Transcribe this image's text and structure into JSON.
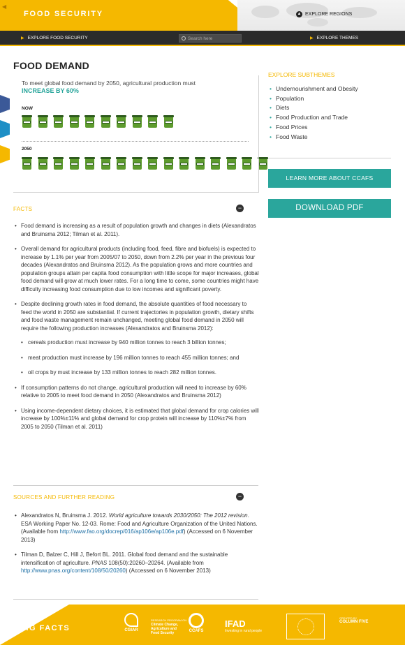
{
  "header": {
    "back_icon": "triangle-left",
    "title": "FOOD SECURITY",
    "explore_regions": "EXPLORE REGIONS",
    "regions_icon_glyph": "▲"
  },
  "navbar": {
    "explore_food_security": "EXPLORE FOOD SECURITY",
    "search_placeholder": "Search here",
    "explore_themes": "EXPLORE THEMES"
  },
  "main": {
    "page_title": "FOOD DEMAND",
    "intro_text": "To meet global food demand by 2050, agricultural production must",
    "highlight": "INCREASE BY 60%",
    "now_label": "NOW",
    "future_label": "2050",
    "bins_now": 10,
    "bins_2050": 16
  },
  "facts": {
    "heading": "FACTS",
    "collapse_glyph": "−",
    "items": [
      "Food demand is increasing as a result of population growth and changes in diets (Alexandratos and Bruinsma 2012; Tilman et al. 2011).",
      "Overall demand for agricultural products (including food, feed, fibre and biofuels) is expected to increase by 1.1% per year from 2005/07 to 2050, down from 2.2% per year in the previous four decades (Alexandratos and Bruinsma 2012). As the population grows and more countries and population groups attain per capita food consumption with little scope for major increases, global food demand will grow at much lower rates. For a long time to come, some countries might have difficulty increasing food consumption due to low incomes and significant poverty.",
      "Despite declining growth rates in food demand, the absolute quantities of food necessary to feed the world in 2050 are substantial. If current trajectories in population growth, dietary shifts and food waste management remain unchanged, meeting global food demand in 2050 will require the following production increases (Alexandratos and Bruinsma 2012):",
      "If consumption patterns do not change, agricultural production will need to increase by 60% relative to 2005 to meet food demand in 2050 (Alexandratos and Bruinsma 2012)",
      "Using income-dependent dietary choices, it is estimated that global demand for crop calories will increase by 100%±11% and global demand for crop protein will increase by 110%±7% from 2005 to 2050 (Tilman et al. 2011)"
    ],
    "sub_items": [
      "cereals production must increase by 940 million tonnes to reach 3 billion tonnes;",
      "meat production must increase by 196 million tonnes to reach 455 million tonnes; and",
      "oil crops by must increase by 133 million tonnes to reach 282 million tonnes."
    ]
  },
  "sources": {
    "heading": "SOURCES AND FURTHER READING",
    "collapse_glyph": "−",
    "s1_authors": "Alexandratos N, Bruinsma J. 2012. ",
    "s1_title": "World agriculture towards 2030/2050: The 2012 revision",
    "s1_rest": ". ESA Working Paper No. 12-03. Rome: Food and Agriculture Organization of the United Nations. (Available from ",
    "s1_link": "http://www.fao.org/docrep/016/ap106e/ap106e.pdf",
    "s1_tail": ") (Accessed on 6 November 2013)",
    "s2_authors": "Tilman D, Balzer C, Hill J, Befort BL. 2011. Global food demand and the sustainable intensification of agriculture. ",
    "s2_journal": "PNAS",
    "s2_rest": " 108(50):20260–20264. (Available from ",
    "s2_link": "http://www.pnas.org/content/108/50/20260",
    "s2_tail": ") (Accessed on 6 November 2013)"
  },
  "sidebar": {
    "heading": "EXPLORE SUBTHEMES",
    "items": [
      "Undernourishment and Obesity",
      "Population",
      "Diets",
      "Food Production and Trade",
      "Food Prices",
      "Food Waste"
    ],
    "learn_more": "LEARN MORE ABOUT CCAFS",
    "download": "DOWNLOAD PDF"
  },
  "footer": {
    "brand": "BIG FACTS",
    "cgiar": "CGIAR",
    "research_program": "RESEARCH PROGRAM ON",
    "rp_line1": "Climate Change,",
    "rp_line2": "Agriculture and",
    "rp_line3": "Food Security",
    "ccafs": "CCAFS",
    "ifad": "IFAD",
    "ifad_tagline": "Investing in rural people",
    "created_by": "CREATED BY",
    "column_five": "COLUMN FIVE"
  },
  "colors": {
    "accent_yellow": "#f5b800",
    "accent_teal": "#2aa69c",
    "nav_dark": "#2b2b2b",
    "bin_green": "#5d9b2d"
  }
}
